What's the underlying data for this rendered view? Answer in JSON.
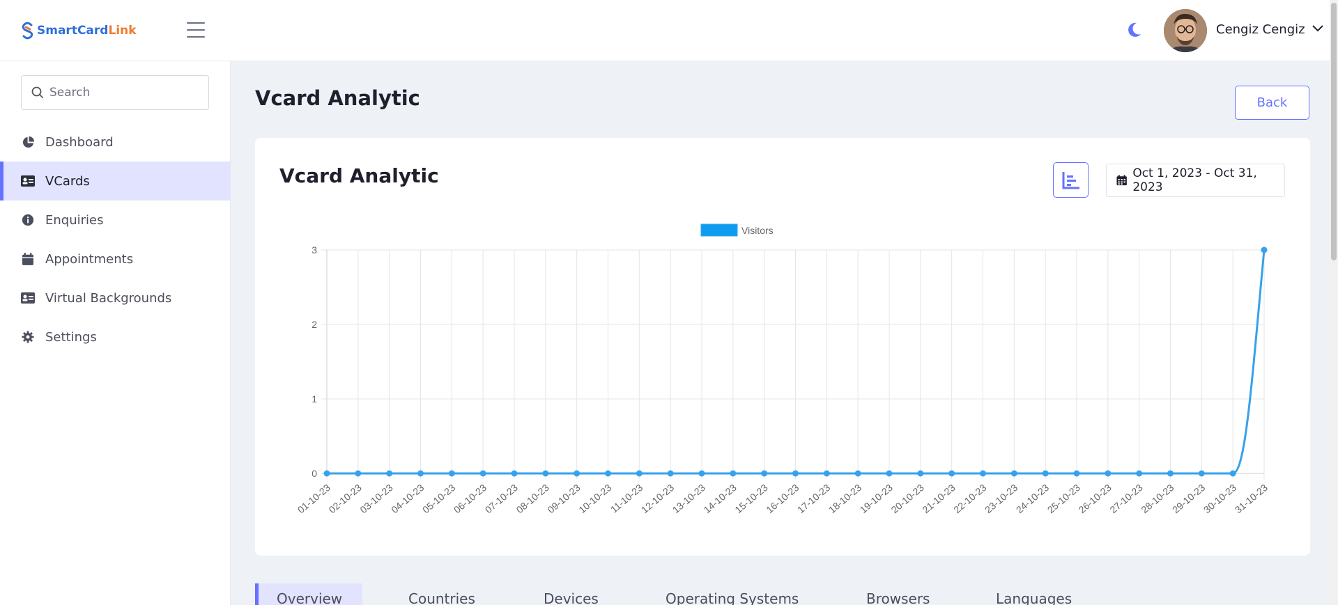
{
  "header": {
    "logo_part1": "SmartCard",
    "logo_part2": "Link",
    "user_name": "Cengiz Cengiz"
  },
  "sidebar": {
    "search_placeholder": "Search",
    "items": [
      {
        "label": "Dashboard",
        "icon": "pie-chart-icon"
      },
      {
        "label": "VCards",
        "icon": "id-card-icon",
        "active": true
      },
      {
        "label": "Enquiries",
        "icon": "info-icon"
      },
      {
        "label": "Appointments",
        "icon": "calendar-icon"
      },
      {
        "label": "Virtual Backgrounds",
        "icon": "id-card-icon"
      },
      {
        "label": "Settings",
        "icon": "gear-icon"
      }
    ]
  },
  "main": {
    "page_title": "Vcard Analytic",
    "back_label": "Back",
    "card_title": "Vcard Analytic",
    "date_range": "Oct 1, 2023 - Oct 31, 2023"
  },
  "tabs": [
    "Overview",
    "Countries",
    "Devices",
    "Operating Systems",
    "Browsers",
    "Languages"
  ],
  "colors": {
    "accent": "#6571ff",
    "series": "#36a2eb",
    "legend_box": "#0d9cf0"
  },
  "chart_data": {
    "type": "line",
    "legend": [
      "Visitors"
    ],
    "categories": [
      "01-10-23",
      "02-10-23",
      "03-10-23",
      "04-10-23",
      "05-10-23",
      "06-10-23",
      "07-10-23",
      "08-10-23",
      "09-10-23",
      "10-10-23",
      "11-10-23",
      "12-10-23",
      "13-10-23",
      "14-10-23",
      "15-10-23",
      "16-10-23",
      "17-10-23",
      "18-10-23",
      "19-10-23",
      "20-10-23",
      "21-10-23",
      "22-10-23",
      "23-10-23",
      "24-10-23",
      "25-10-23",
      "26-10-23",
      "27-10-23",
      "28-10-23",
      "29-10-23",
      "30-10-23",
      "31-10-23"
    ],
    "series": [
      {
        "name": "Visitors",
        "values": [
          0,
          0,
          0,
          0,
          0,
          0,
          0,
          0,
          0,
          0,
          0,
          0,
          0,
          0,
          0,
          0,
          0,
          0,
          0,
          0,
          0,
          0,
          0,
          0,
          0,
          0,
          0,
          0,
          0,
          0,
          3
        ]
      }
    ],
    "y_ticks": [
      0,
      1,
      2,
      3
    ],
    "ylim": [
      0,
      3
    ],
    "grid": true,
    "legend_position": "top"
  }
}
